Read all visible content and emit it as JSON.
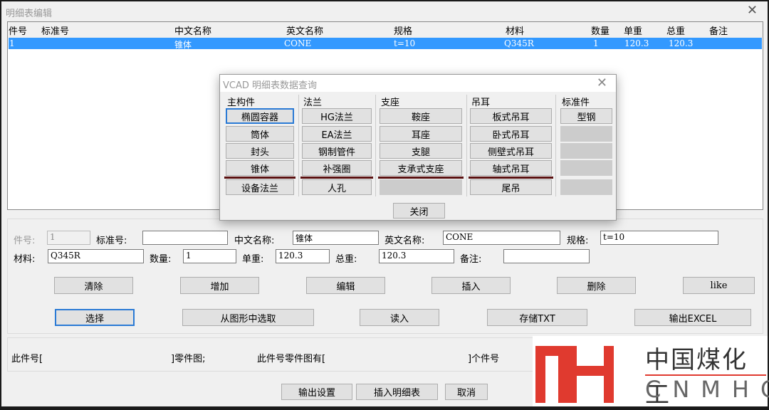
{
  "window": {
    "title": "明细表编辑",
    "close_icon": "close-icon"
  },
  "table": {
    "columns": [
      "件号",
      "标准号",
      "中文名称",
      "英文名称",
      "规格",
      "材料",
      "数量",
      "单重",
      "总重",
      "备注"
    ],
    "rows": [
      [
        "1",
        "",
        "锥体",
        "CONE",
        "t=10",
        "Q345R",
        "1",
        "120.3",
        "120.3",
        ""
      ]
    ],
    "selected_color": "#3399ff"
  },
  "dialog": {
    "title": "VCAD 明细表数据查询",
    "groups": [
      {
        "label": "主构件",
        "items": [
          "椭圆容器",
          "筒体",
          "封头",
          "锥体",
          "设备法兰"
        ]
      },
      {
        "label": "法兰",
        "items": [
          "HG法兰",
          "EA法兰",
          "钢制管件",
          "补强圈",
          "人孔"
        ]
      },
      {
        "label": "支座",
        "items": [
          "鞍座",
          "耳座",
          "支腿",
          "支承式支座",
          ""
        ]
      },
      {
        "label": "吊耳",
        "items": [
          "板式吊耳",
          "卧式吊耳",
          "侧壁式吊耳",
          "轴式吊耳",
          "尾吊"
        ]
      },
      {
        "label": "标准件",
        "items": [
          "型钢",
          "",
          "",
          "",
          ""
        ]
      }
    ],
    "close_label": "关闭"
  },
  "form": {
    "part_no": {
      "label": "件号:",
      "value": "1"
    },
    "std_no": {
      "label": "标准号:",
      "value": ""
    },
    "cn_name": {
      "label": "中文名称:",
      "value": "锥体"
    },
    "en_name": {
      "label": "英文名称:",
      "value": "CONE"
    },
    "spec": {
      "label": "规格:",
      "value": "t=10"
    },
    "material": {
      "label": "材料:",
      "value": "Q345R"
    },
    "qty": {
      "label": "数量:",
      "value": "1"
    },
    "unit_wt": {
      "label": "单重:",
      "value": "120.3"
    },
    "total_wt": {
      "label": "总重:",
      "value": "120.3"
    },
    "remark": {
      "label": "备注:",
      "value": ""
    }
  },
  "actions1": [
    "清除",
    "增加",
    "编辑",
    "插入",
    "删除",
    "like"
  ],
  "actions2": [
    "选择",
    "从图形中选取",
    "读入",
    "存储TXT",
    "输出EXCEL"
  ],
  "info": {
    "a": "此件号[",
    "b": "]零件图;",
    "c": "此件号零件图有[",
    "d": "]个件号"
  },
  "footer": {
    "output_settings": "输出设置",
    "insert_table": "插入明细表",
    "cancel": "取消"
  },
  "watermark": {
    "cn": "中国煤化工",
    "en": "CNMHG",
    "color": "#e03a2f"
  }
}
